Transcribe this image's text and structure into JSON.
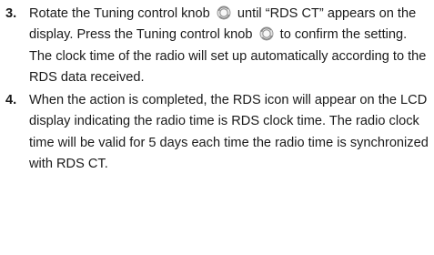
{
  "steps": [
    {
      "number": "3.",
      "parts": [
        "Rotate the Tuning control knob",
        "until “RDS CT” appears on the display. Press the Tuning control knob",
        "to confirm the setting. The clock time of the radio will set up automatically according to the RDS data received."
      ],
      "icon": "tuning-knob-icon"
    },
    {
      "number": "4.",
      "text": "When the action is completed, the RDS icon will appear on the LCD display indicating the radio time is RDS clock time. The radio clock time will be valid for 5 days each time the radio time is synchronized with RDS CT."
    }
  ]
}
